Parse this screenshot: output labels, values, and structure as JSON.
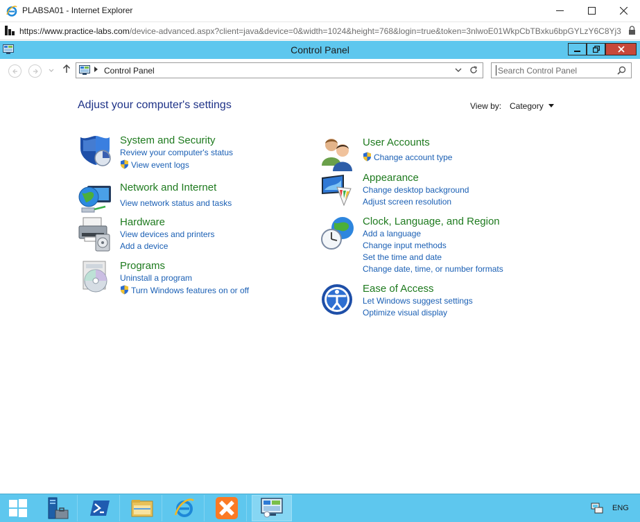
{
  "browser": {
    "window_title": "PLABSA01 - Internet Explorer",
    "url_scheme": "https://www.",
    "url_host": "practice-labs.com",
    "url_path": "/device-advanced.aspx?client=java&device=0&width=1024&height=768&login=true&token=3nlwoE01WkpCbTBxku6bpGYLzY6C8Yj3"
  },
  "window": {
    "title": "Control Panel"
  },
  "navbar": {
    "breadcrumb": "Control Panel",
    "search_placeholder": "Search Control Panel"
  },
  "main": {
    "heading": "Adjust your computer's settings",
    "view_by_label": "View by:",
    "view_by_value": "Category"
  },
  "categories": {
    "system_security": {
      "title": "System and Security",
      "links": [
        "Review your computer's status",
        "View event logs"
      ]
    },
    "network": {
      "title": "Network and Internet",
      "links": [
        "View network status and tasks"
      ]
    },
    "hardware": {
      "title": "Hardware",
      "links": [
        "View devices and printers",
        "Add a device"
      ]
    },
    "programs": {
      "title": "Programs",
      "links": [
        "Uninstall a program",
        "Turn Windows features on or off"
      ]
    },
    "user_accounts": {
      "title": "User Accounts",
      "links": [
        "Change account type"
      ]
    },
    "appearance": {
      "title": "Appearance",
      "links": [
        "Change desktop background",
        "Adjust screen resolution"
      ]
    },
    "clock": {
      "title": "Clock, Language, and Region",
      "links": [
        "Add a language",
        "Change input methods",
        "Set the time and date",
        "Change date, time, or number formats"
      ]
    },
    "ease": {
      "title": "Ease of Access",
      "links": [
        "Let Windows suggest settings",
        "Optimize visual display"
      ]
    }
  },
  "taskbar": {
    "items": [
      "start-icon",
      "server-manager-icon",
      "powershell-icon",
      "file-explorer-icon",
      "internet-explorer-icon",
      "xampp-icon",
      "control-panel-icon"
    ],
    "language": "ENG"
  },
  "colors": {
    "accent": "#5ec7ee",
    "heading_blue": "#1e3287",
    "category_green": "#1e7a1e",
    "link_blue": "#1a5fb4"
  }
}
